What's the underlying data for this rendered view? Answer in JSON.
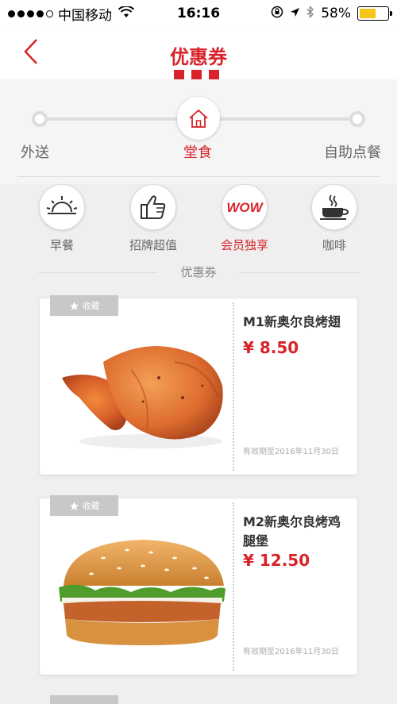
{
  "status_bar": {
    "carrier": "中国移动",
    "time": "16:16",
    "battery_percent": "58%",
    "battery_level": 0.58
  },
  "nav": {
    "title": "优惠券"
  },
  "modes": [
    {
      "label": "外送",
      "active": false
    },
    {
      "label": "堂食",
      "active": true
    },
    {
      "label": "自助点餐",
      "active": false
    }
  ],
  "categories": [
    {
      "label": "早餐",
      "icon": "sunrise-icon",
      "active": false
    },
    {
      "label": "招牌超值",
      "icon": "thumbs-up-icon",
      "active": false
    },
    {
      "label": "会员独享",
      "icon": "wow-icon",
      "active": true,
      "icon_text": "WOW"
    },
    {
      "label": "咖啡",
      "icon": "coffee-cup-icon",
      "active": false
    }
  ],
  "section_title": "优惠券",
  "coupons": [
    {
      "tag": "收藏",
      "name": "M1新奥尔良烤翅",
      "price": "¥ 8.50",
      "validity": "有效期至2016年11月30日",
      "image": "chicken-wings-image"
    },
    {
      "tag": "收藏",
      "name": "M2新奥尔良烤鸡腿堡",
      "price": "¥ 12.50",
      "validity": "有效期至2016年11月30日",
      "image": "burger-image"
    }
  ],
  "colors": {
    "accent": "#d8232a",
    "background": "#efefef",
    "tag": "#c8c8c8"
  }
}
